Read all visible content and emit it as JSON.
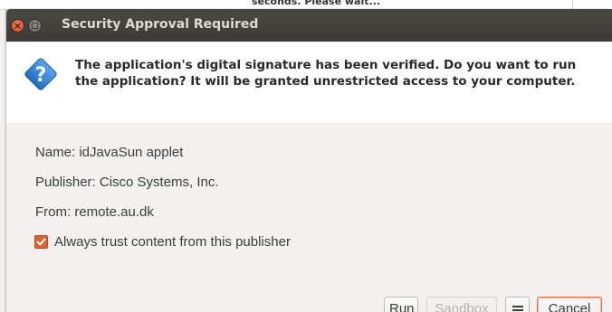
{
  "background_window": {
    "text": "seconds. Please wait..."
  },
  "dialog": {
    "title": "Security Approval Required",
    "close_glyph": "×",
    "icon": "question-icon",
    "question_glyph": "?",
    "header": {
      "line1": "The application's digital signature has been verified. Do you want to run",
      "line2": "the application? It will be granted unrestricted access to your computer."
    },
    "info": {
      "name": "Name:  idJavaSun applet",
      "publisher": "Publisher: Cisco Systems, Inc.",
      "from": "From:  remote.au.dk"
    },
    "trust_checkbox": {
      "label": "Always trust content from this publisher",
      "checked": true
    },
    "buttons": {
      "run": "Run",
      "sandbox": "Sandbox",
      "more": "menu-icon",
      "cancel": "Cancel"
    }
  },
  "colors": {
    "titlebar": "#3c3b37",
    "title_text": "#dfdbd2",
    "close_button": "#df4a16",
    "icon_blue": "#2a7fd4",
    "checkbox_accent": "#dd6131",
    "dialog_bg": "#f2f1f0"
  }
}
